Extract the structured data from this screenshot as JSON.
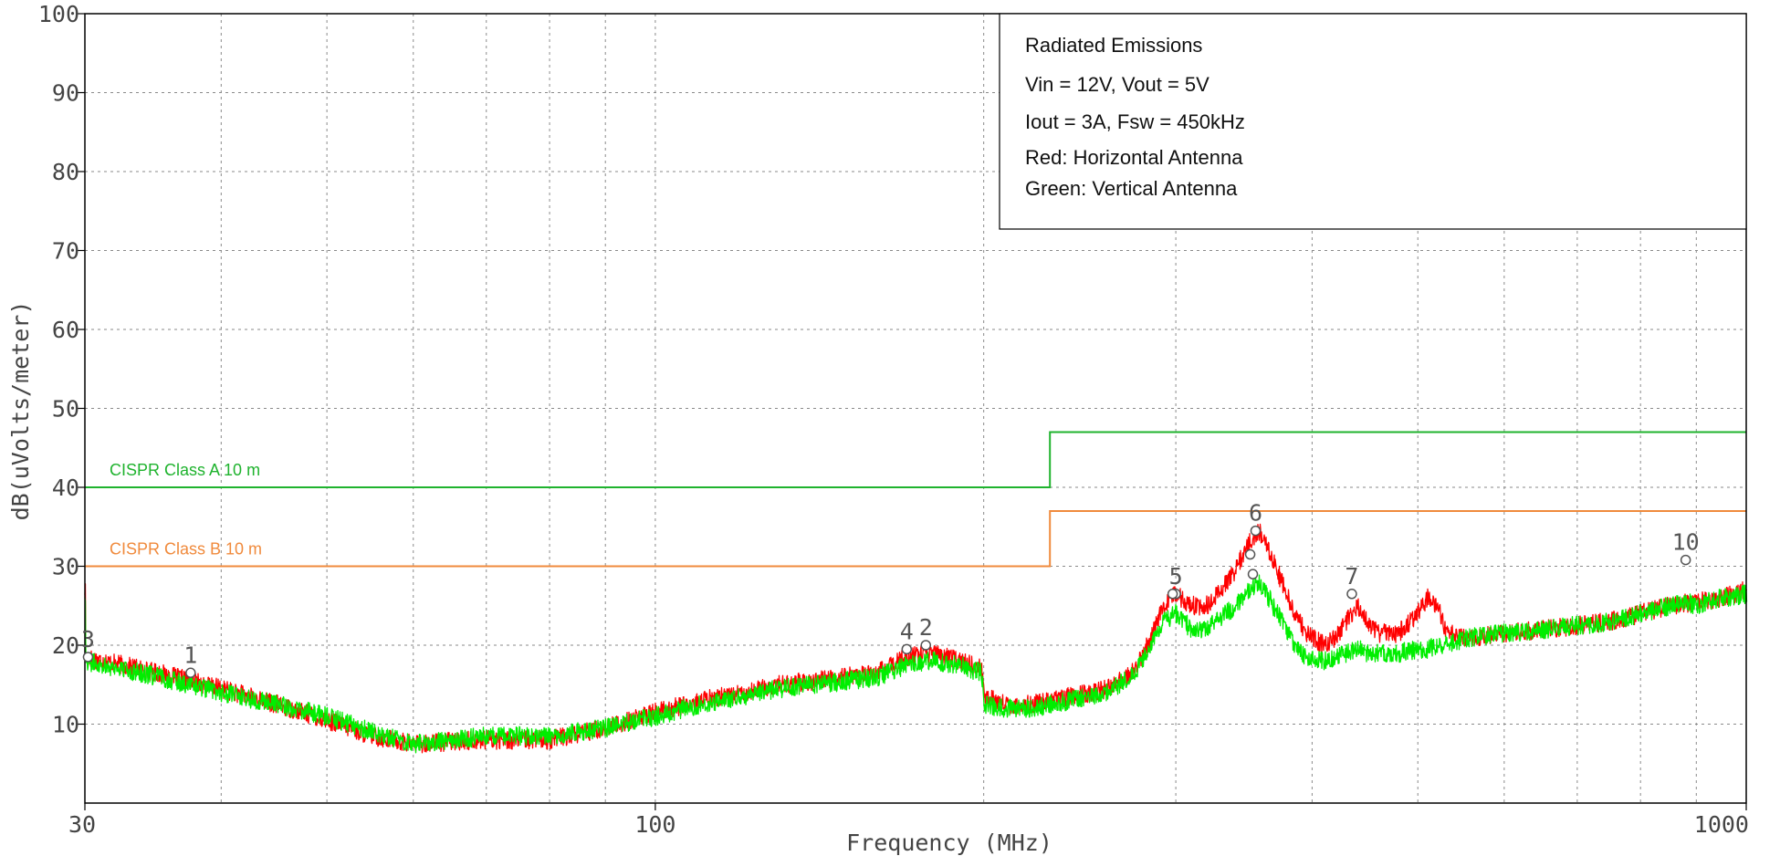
{
  "chart_data": {
    "type": "line",
    "title": "",
    "xlabel": "Frequency (MHz)",
    "ylabel": "dB(uVolts/meter)",
    "x_scale": "log",
    "xlim": [
      30,
      1000
    ],
    "ylim": [
      0,
      100
    ],
    "grid": true,
    "x_ticks": [
      {
        "value": 30,
        "label": "30"
      },
      {
        "value": 100,
        "label": "100"
      },
      {
        "value": 1000,
        "label": "1000"
      }
    ],
    "x_minor_grid": [
      40,
      50,
      60,
      70,
      80,
      90,
      200,
      300,
      400,
      500,
      600,
      700,
      800,
      900
    ],
    "y_ticks": [
      {
        "value": 10,
        "label": "10"
      },
      {
        "value": 20,
        "label": "20"
      },
      {
        "value": 30,
        "label": "30"
      },
      {
        "value": 40,
        "label": "40"
      },
      {
        "value": 50,
        "label": "50"
      },
      {
        "value": 60,
        "label": "60"
      },
      {
        "value": 70,
        "label": "70"
      },
      {
        "value": 80,
        "label": "80"
      },
      {
        "value": 90,
        "label": "90"
      },
      {
        "value": 100,
        "label": "100"
      }
    ],
    "annotation_lines": [
      "Radiated Emissions",
      "Vin = 12V, Vout = 5V",
      "Iout = 3A, Fsw = 450kHz",
      "Red: Horizontal Antenna",
      "Green: Vertical Antenna"
    ],
    "limits": [
      {
        "label": "CISPR   Class A   10 m",
        "color": "#1fb32e",
        "points": [
          [
            30,
            40
          ],
          [
            230,
            40
          ],
          [
            230,
            47
          ],
          [
            1000,
            47
          ]
        ]
      },
      {
        "label": "CISPR   Class B   10 m",
        "color": "#f08a3c",
        "points": [
          [
            30,
            30
          ],
          [
            230,
            30
          ],
          [
            230,
            37
          ],
          [
            1000,
            37
          ]
        ]
      }
    ],
    "series": [
      {
        "color": "#ff0000",
        "points": [
          [
            30,
            18.5
          ],
          [
            35,
            16.5
          ],
          [
            40,
            14.5
          ],
          [
            45,
            12.5
          ],
          [
            50,
            10.5
          ],
          [
            55,
            8.5
          ],
          [
            60,
            7.5
          ],
          [
            65,
            7.8
          ],
          [
            70,
            8
          ],
          [
            80,
            8
          ],
          [
            90,
            9.5
          ],
          [
            100,
            11.5
          ],
          [
            110,
            13
          ],
          [
            120,
            14
          ],
          [
            130,
            15
          ],
          [
            140,
            15.5
          ],
          [
            150,
            16
          ],
          [
            160,
            16.5
          ],
          [
            170,
            18.5
          ],
          [
            180,
            19
          ],
          [
            190,
            18
          ],
          [
            199,
            17
          ],
          [
            200,
            13.5
          ],
          [
            210,
            12.5
          ],
          [
            220,
            12.5
          ],
          [
            230,
            13
          ],
          [
            240,
            13.5
          ],
          [
            250,
            14
          ],
          [
            260,
            14.5
          ],
          [
            275,
            17
          ],
          [
            285,
            21
          ],
          [
            292,
            25
          ],
          [
            300,
            26.5
          ],
          [
            310,
            25
          ],
          [
            320,
            25
          ],
          [
            330,
            27
          ],
          [
            340,
            29.5
          ],
          [
            350,
            33
          ],
          [
            357,
            34.5
          ],
          [
            365,
            32
          ],
          [
            375,
            28
          ],
          [
            385,
            24
          ],
          [
            395,
            21.5
          ],
          [
            410,
            20
          ],
          [
            420,
            21
          ],
          [
            430,
            23
          ],
          [
            440,
            25
          ],
          [
            450,
            23
          ],
          [
            460,
            21.5
          ],
          [
            480,
            21.5
          ],
          [
            500,
            24
          ],
          [
            510,
            26
          ],
          [
            520,
            25
          ],
          [
            530,
            22
          ],
          [
            545,
            21
          ],
          [
            560,
            21
          ],
          [
            600,
            21.5
          ],
          [
            650,
            22
          ],
          [
            700,
            22.5
          ],
          [
            750,
            23
          ],
          [
            800,
            24
          ],
          [
            850,
            25
          ],
          [
            900,
            25.5
          ],
          [
            950,
            26
          ],
          [
            1000,
            27
          ]
        ]
      },
      {
        "color": "#00ee00",
        "points": [
          [
            30,
            18
          ],
          [
            35,
            16
          ],
          [
            40,
            14
          ],
          [
            45,
            12.5
          ],
          [
            50,
            11
          ],
          [
            55,
            9
          ],
          [
            60,
            7.5
          ],
          [
            65,
            8
          ],
          [
            70,
            8.5
          ],
          [
            80,
            8.5
          ],
          [
            90,
            9.5
          ],
          [
            100,
            11
          ],
          [
            110,
            12.5
          ],
          [
            120,
            13.5
          ],
          [
            130,
            14.5
          ],
          [
            140,
            15
          ],
          [
            150,
            15.5
          ],
          [
            160,
            16
          ],
          [
            170,
            17.5
          ],
          [
            180,
            18
          ],
          [
            190,
            17.5
          ],
          [
            199,
            16.5
          ],
          [
            200,
            12.5
          ],
          [
            210,
            12
          ],
          [
            220,
            12
          ],
          [
            230,
            12.5
          ],
          [
            240,
            13
          ],
          [
            250,
            13.5
          ],
          [
            260,
            14
          ],
          [
            275,
            16.5
          ],
          [
            285,
            20
          ],
          [
            292,
            23
          ],
          [
            300,
            24
          ],
          [
            310,
            22
          ],
          [
            320,
            22
          ],
          [
            330,
            23.5
          ],
          [
            340,
            25
          ],
          [
            350,
            27
          ],
          [
            357,
            28
          ],
          [
            365,
            26
          ],
          [
            375,
            23
          ],
          [
            385,
            20
          ],
          [
            395,
            18.5
          ],
          [
            410,
            18
          ],
          [
            420,
            18.5
          ],
          [
            430,
            19
          ],
          [
            440,
            19.5
          ],
          [
            450,
            19
          ],
          [
            460,
            19
          ],
          [
            480,
            19
          ],
          [
            500,
            19.5
          ],
          [
            510,
            19.5
          ],
          [
            520,
            20
          ],
          [
            530,
            20
          ],
          [
            545,
            20.5
          ],
          [
            560,
            21
          ],
          [
            600,
            21.5
          ],
          [
            650,
            22
          ],
          [
            700,
            22.5
          ],
          [
            750,
            23
          ],
          [
            800,
            24
          ],
          [
            850,
            25
          ],
          [
            880,
            25.5
          ],
          [
            900,
            25
          ],
          [
            950,
            26
          ],
          [
            1000,
            26.5
          ]
        ]
      }
    ],
    "markers": [
      {
        "label": "1",
        "x": 37.5,
        "y": 16.5
      },
      {
        "label": "2",
        "x": 177,
        "y": 20
      },
      {
        "label": "3",
        "x": 30.2,
        "y": 18.5
      },
      {
        "label": "4",
        "x": 170,
        "y": 19.5
      },
      {
        "label": "5",
        "x": 300,
        "y": 26.5
      },
      {
        "label": "",
        "x": 298,
        "y": 26.5
      },
      {
        "label": "6",
        "x": 355,
        "y": 34.5
      },
      {
        "label": "",
        "x": 351,
        "y": 31.5
      },
      {
        "label": "",
        "x": 353,
        "y": 29
      },
      {
        "label": "7",
        "x": 435,
        "y": 26.5
      },
      {
        "label": "10",
        "x": 880,
        "y": 30.8
      }
    ]
  }
}
